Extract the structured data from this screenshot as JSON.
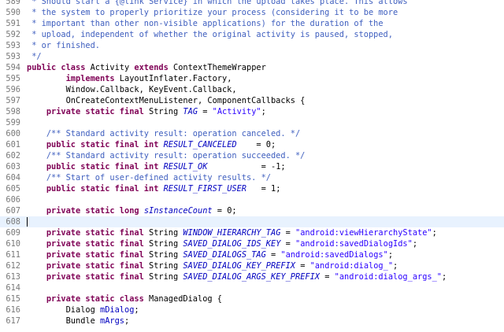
{
  "colors": {
    "comment": "#3f5fbf",
    "keyword": "#7f0055",
    "string": "#2a00ff",
    "field": "#0000c0",
    "line_number": "#787878",
    "current_line": "#e8f2fe"
  },
  "editor": {
    "lines": [
      {
        "n": "589",
        "tokens": [
          {
            "t": "cm",
            "v": " * Should start a {@link Service} in which the upload takes place. This allows"
          }
        ]
      },
      {
        "n": "590",
        "tokens": [
          {
            "t": "cm",
            "v": " * the system to properly prioritize your process (considering it to be more"
          }
        ]
      },
      {
        "n": "591",
        "tokens": [
          {
            "t": "cm",
            "v": " * important than other non-visible applications) for the duration of the"
          }
        ]
      },
      {
        "n": "592",
        "tokens": [
          {
            "t": "cm",
            "v": " * upload, independent of whether the original activity is paused, stopped,"
          }
        ]
      },
      {
        "n": "593",
        "tokens": [
          {
            "t": "cm",
            "v": " * or finished."
          }
        ]
      },
      {
        "n": "593",
        "tokens": [
          {
            "t": "cm",
            "v": " */"
          }
        ]
      },
      {
        "n": "594",
        "tokens": [
          {
            "t": "kw",
            "v": "public class"
          },
          {
            "t": "pl",
            "v": " Activity "
          },
          {
            "t": "kw",
            "v": "extends"
          },
          {
            "t": "pl",
            "v": " ContextThemeWrapper"
          }
        ]
      },
      {
        "n": "595",
        "tokens": [
          {
            "t": "pl",
            "v": "        "
          },
          {
            "t": "kw",
            "v": "implements"
          },
          {
            "t": "pl",
            "v": " LayoutInflater.Factory,"
          }
        ]
      },
      {
        "n": "596",
        "tokens": [
          {
            "t": "pl",
            "v": "        Window.Callback, KeyEvent.Callback,"
          }
        ]
      },
      {
        "n": "597",
        "tokens": [
          {
            "t": "pl",
            "v": "        OnCreateContextMenuListener, ComponentCallbacks {"
          }
        ]
      },
      {
        "n": "598",
        "tokens": [
          {
            "t": "pl",
            "v": "    "
          },
          {
            "t": "kw",
            "v": "private static final"
          },
          {
            "t": "pl",
            "v": " String "
          },
          {
            "t": "fi",
            "v": "TAG"
          },
          {
            "t": "pl",
            "v": " = "
          },
          {
            "t": "st",
            "v": "\"Activity\""
          },
          {
            "t": "pl",
            "v": ";"
          }
        ]
      },
      {
        "n": "599",
        "tokens": []
      },
      {
        "n": "600",
        "tokens": [
          {
            "t": "pl",
            "v": "    "
          },
          {
            "t": "cm",
            "v": "/** Standard activity result: operation canceled. */"
          }
        ]
      },
      {
        "n": "601",
        "tokens": [
          {
            "t": "pl",
            "v": "    "
          },
          {
            "t": "kw",
            "v": "public static final int"
          },
          {
            "t": "pl",
            "v": " "
          },
          {
            "t": "fi",
            "v": "RESULT_CANCELED"
          },
          {
            "t": "pl",
            "v": "    = 0;"
          }
        ]
      },
      {
        "n": "602",
        "tokens": [
          {
            "t": "pl",
            "v": "    "
          },
          {
            "t": "cm",
            "v": "/** Standard activity result: operation succeeded. */"
          }
        ]
      },
      {
        "n": "603",
        "tokens": [
          {
            "t": "pl",
            "v": "    "
          },
          {
            "t": "kw",
            "v": "public static final int"
          },
          {
            "t": "pl",
            "v": " "
          },
          {
            "t": "fi",
            "v": "RESULT_OK"
          },
          {
            "t": "pl",
            "v": "           = -1;"
          }
        ]
      },
      {
        "n": "604",
        "tokens": [
          {
            "t": "pl",
            "v": "    "
          },
          {
            "t": "cm",
            "v": "/** Start of user-defined activity results. */"
          }
        ]
      },
      {
        "n": "605",
        "tokens": [
          {
            "t": "pl",
            "v": "    "
          },
          {
            "t": "kw",
            "v": "public static final int"
          },
          {
            "t": "pl",
            "v": " "
          },
          {
            "t": "fi",
            "v": "RESULT_FIRST_USER"
          },
          {
            "t": "pl",
            "v": "   = 1;"
          }
        ]
      },
      {
        "n": "606",
        "tokens": []
      },
      {
        "n": "607",
        "tokens": [
          {
            "t": "pl",
            "v": "    "
          },
          {
            "t": "kw",
            "v": "private static long"
          },
          {
            "t": "pl",
            "v": " "
          },
          {
            "t": "fi",
            "v": "sInstanceCount"
          },
          {
            "t": "pl",
            "v": " = 0;"
          }
        ]
      },
      {
        "n": "608",
        "current": true,
        "tokens": []
      },
      {
        "n": "609",
        "tokens": [
          {
            "t": "pl",
            "v": "    "
          },
          {
            "t": "kw",
            "v": "private static final"
          },
          {
            "t": "pl",
            "v": " String "
          },
          {
            "t": "fi",
            "v": "WINDOW_HIERARCHY_TAG"
          },
          {
            "t": "pl",
            "v": " = "
          },
          {
            "t": "st",
            "v": "\"android:viewHierarchyState\""
          },
          {
            "t": "pl",
            "v": ";"
          }
        ]
      },
      {
        "n": "610",
        "tokens": [
          {
            "t": "pl",
            "v": "    "
          },
          {
            "t": "kw",
            "v": "private static final"
          },
          {
            "t": "pl",
            "v": " String "
          },
          {
            "t": "fi",
            "v": "SAVED_DIALOG_IDS_KEY"
          },
          {
            "t": "pl",
            "v": " = "
          },
          {
            "t": "st",
            "v": "\"android:savedDialogIds\""
          },
          {
            "t": "pl",
            "v": ";"
          }
        ]
      },
      {
        "n": "611",
        "tokens": [
          {
            "t": "pl",
            "v": "    "
          },
          {
            "t": "kw",
            "v": "private static final"
          },
          {
            "t": "pl",
            "v": " String "
          },
          {
            "t": "fi",
            "v": "SAVED_DIALOGS_TAG"
          },
          {
            "t": "pl",
            "v": " = "
          },
          {
            "t": "st",
            "v": "\"android:savedDialogs\""
          },
          {
            "t": "pl",
            "v": ";"
          }
        ]
      },
      {
        "n": "612",
        "tokens": [
          {
            "t": "pl",
            "v": "    "
          },
          {
            "t": "kw",
            "v": "private static final"
          },
          {
            "t": "pl",
            "v": " String "
          },
          {
            "t": "fi",
            "v": "SAVED_DIALOG_KEY_PREFIX"
          },
          {
            "t": "pl",
            "v": " = "
          },
          {
            "t": "st",
            "v": "\"android:dialog_\""
          },
          {
            "t": "pl",
            "v": ";"
          }
        ]
      },
      {
        "n": "613",
        "tokens": [
          {
            "t": "pl",
            "v": "    "
          },
          {
            "t": "kw",
            "v": "private static final"
          },
          {
            "t": "pl",
            "v": " String "
          },
          {
            "t": "fi",
            "v": "SAVED_DIALOG_ARGS_KEY_PREFIX"
          },
          {
            "t": "pl",
            "v": " = "
          },
          {
            "t": "st",
            "v": "\"android:dialog_args_\""
          },
          {
            "t": "pl",
            "v": ";"
          }
        ]
      },
      {
        "n": "614",
        "tokens": []
      },
      {
        "n": "615",
        "tokens": [
          {
            "t": "pl",
            "v": "    "
          },
          {
            "t": "kw",
            "v": "private static class"
          },
          {
            "t": "pl",
            "v": " ManagedDialog {"
          }
        ]
      },
      {
        "n": "616",
        "tokens": [
          {
            "t": "pl",
            "v": "        Dialog "
          },
          {
            "t": "fd",
            "v": "mDialog"
          },
          {
            "t": "pl",
            "v": ";"
          }
        ]
      },
      {
        "n": "617",
        "tokens": [
          {
            "t": "pl",
            "v": "        Bundle "
          },
          {
            "t": "fd",
            "v": "mArgs"
          },
          {
            "t": "pl",
            "v": ";"
          }
        ]
      }
    ]
  }
}
